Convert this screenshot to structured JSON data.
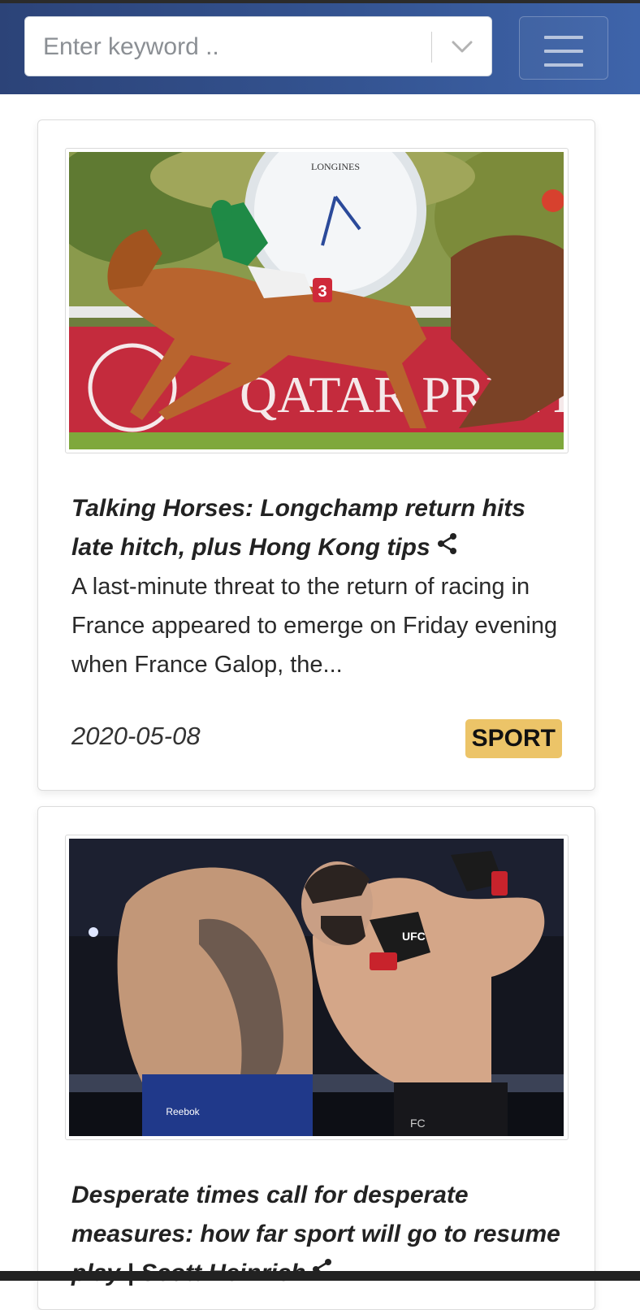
{
  "search": {
    "placeholder": "Enter keyword .."
  },
  "icons": {
    "dropdown": "chevron-down-icon",
    "menu": "hamburger-menu-icon",
    "share": "share-icon"
  },
  "colors": {
    "header_start": "#2c4378",
    "header_end": "#3e64aa",
    "badge": "#ecc468"
  },
  "articles": [
    {
      "title": "Talking Horses: Longchamp return hits late hitch, plus Hong Kong tips",
      "description": "A last-minute threat to the return of racing in France appeared to emerge on Friday evening when France Galop, the...",
      "date": "2020-05-08",
      "category": "SPORT",
      "image_text": {
        "banner": "QATAR PRIX DE L",
        "clock_brand": "LONGINES",
        "saddle_number": "3"
      }
    },
    {
      "title": "Desperate times call for desperate measures: how far sport will go to resume play | Scott Heinrich",
      "image_text": {
        "glove": "UFC",
        "shorts": "Reebok",
        "shorts2": "FC"
      }
    }
  ]
}
